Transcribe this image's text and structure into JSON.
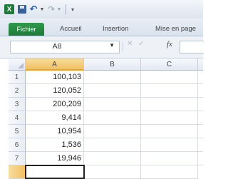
{
  "toolbar": {
    "app_icon_label": "X",
    "icons": [
      "excel-icon",
      "save-icon",
      "undo-icon",
      "redo-icon",
      "customize-toolbar-icon"
    ]
  },
  "ribbon": {
    "tabs": [
      {
        "label": "Fichier"
      },
      {
        "label": "Accueil"
      },
      {
        "label": "Insertion"
      },
      {
        "label": "Mise en page"
      }
    ]
  },
  "formula_bar": {
    "name_box": "A8",
    "fx_label": "fx",
    "formula": ""
  },
  "sheet": {
    "columns": [
      "A",
      "B",
      "C"
    ],
    "rows": [
      {
        "num": "1",
        "a": "100,103"
      },
      {
        "num": "2",
        "a": "120,052"
      },
      {
        "num": "3",
        "a": "200,209"
      },
      {
        "num": "4",
        "a": "9,414"
      },
      {
        "num": "5",
        "a": "10,954"
      },
      {
        "num": "6",
        "a": "1,536"
      },
      {
        "num": "7",
        "a": "19,946"
      }
    ],
    "selected_cell": "A8"
  },
  "colors": {
    "file_tab": "#1f7a3a",
    "selected_header": "#f1c15f"
  }
}
